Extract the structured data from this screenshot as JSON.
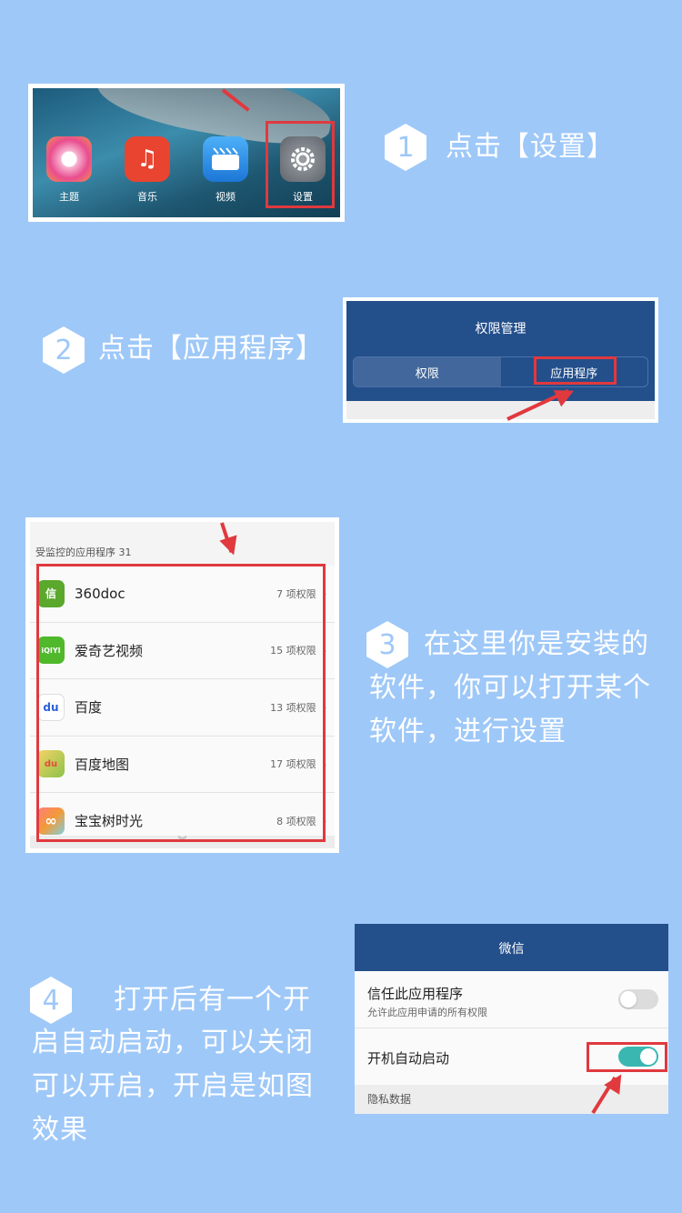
{
  "step1": {
    "number": "1",
    "text": "点击【设置】",
    "apps": [
      {
        "label": "主题",
        "icon": "theme-icon",
        "color": "#f06292"
      },
      {
        "label": "音乐",
        "icon": "music-icon",
        "color": "#e8442f"
      },
      {
        "label": "视频",
        "icon": "video-icon",
        "color": "#2d8ce8"
      },
      {
        "label": "设置",
        "icon": "gear-icon",
        "color": "#8a9096"
      }
    ]
  },
  "step2": {
    "number": "2",
    "text": "点击【应用程序】",
    "screen_title": "权限管理",
    "tabs": [
      "权限",
      "应用程序"
    ]
  },
  "step3": {
    "number": "3",
    "text_lines": [
      "在这里你是安装的",
      "软件，你可以打开某个",
      "软件，进行设置"
    ],
    "section": "受监控的应用程序 31",
    "apps": [
      {
        "name": "360doc",
        "perm": "7 项权限",
        "icon": "360doc-icon",
        "color": "#5aa82c",
        "glyph": "信"
      },
      {
        "name": "爱奇艺视频",
        "perm": "15 项权限",
        "icon": "iqiyi-icon",
        "color": "#4fb82b",
        "glyph": "iQIYI"
      },
      {
        "name": "百度",
        "perm": "13 项权限",
        "icon": "baidu-icon",
        "color": "#2a5fd6",
        "glyph": "du"
      },
      {
        "name": "百度地图",
        "perm": "17 项权限",
        "icon": "baidu-map-icon",
        "color": "#e64a3c",
        "glyph": "du"
      },
      {
        "name": "宝宝树时光",
        "perm": "8 项权限",
        "icon": "babytree-icon",
        "color": "#f29a38",
        "glyph": "∞"
      }
    ]
  },
  "step4": {
    "number": "4",
    "text_lines": [
      "打开后有一个开",
      "启自动启动，可以关闭",
      "可以开启，开启是如图",
      "效果"
    ],
    "screen_title": "微信",
    "trust_title": "信任此应用程序",
    "trust_sub": "允许此应用申请的所有权限",
    "autostart": "开机自动启动",
    "privacy": "隐私数据",
    "trust_on": false,
    "autostart_on": true
  },
  "colors": {
    "background": "#9ec8f8",
    "header": "#234f8b",
    "highlight": "#e0393e",
    "toggle_on": "#3bb7b2"
  }
}
